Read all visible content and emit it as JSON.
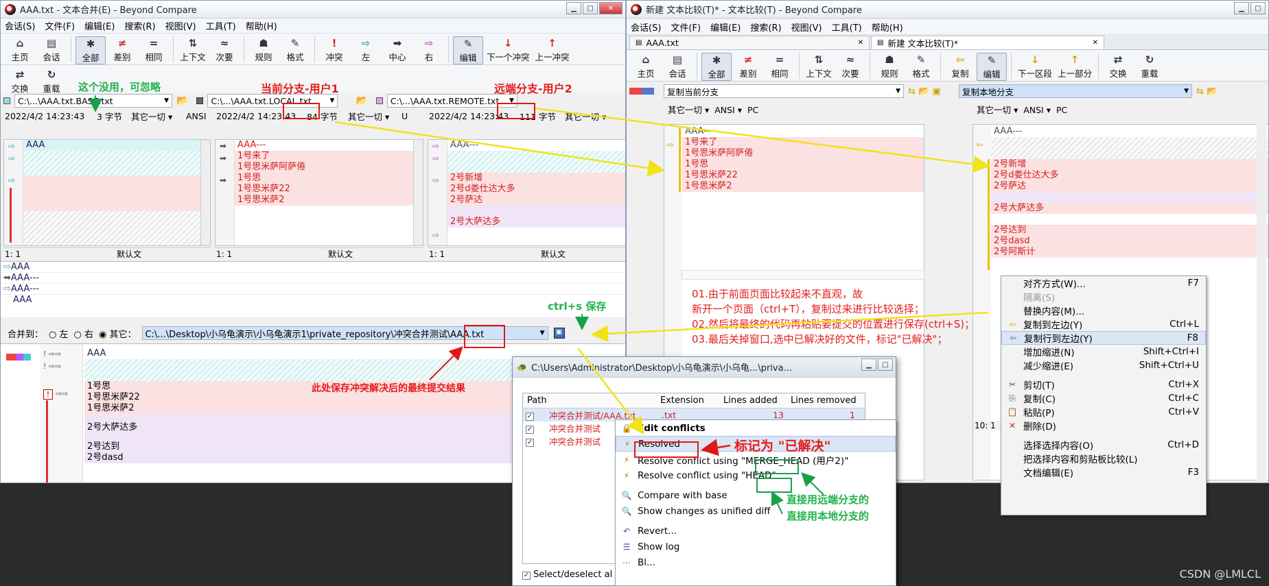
{
  "left_window": {
    "title": "AAA.txt - 文本合并(E) - Beyond Compare",
    "menu": [
      "会话(S)",
      "文件(F)",
      "编辑(E)",
      "搜索(R)",
      "视图(V)",
      "工具(T)",
      "帮助(H)"
    ],
    "toolbar": [
      "主页",
      "会话",
      "全部",
      "差别",
      "相同",
      "上下文",
      "次要",
      "规则",
      "格式",
      "冲突",
      "左",
      "中心",
      "右",
      "编辑",
      "下一个冲突",
      "上一冲突"
    ],
    "toolbar2": [
      "交换",
      "重载"
    ],
    "paths": {
      "base": "C:\\...\\AAA.txt.BASE.txt",
      "local": "C:\\...\\AAA.txt.LOCAL.txt",
      "remote": "C:\\...\\AAA.txt.REMOTE.txt"
    },
    "info": {
      "base": [
        "2022/4/2 14:23:43",
        "3 字节",
        "其它一切",
        "ANSI"
      ],
      "local": [
        "2022/4/2 14:23:43",
        "84 字节",
        "其它一切",
        "U"
      ],
      "remote": [
        "2022/4/2 14:23:43",
        "111 字节",
        "其它一切"
      ]
    },
    "base_lines": [
      "AAA"
    ],
    "local_lines": [
      "AAA---",
      "1号来了",
      "1号思米萨阿萨倦",
      "1号思",
      "1号思米萨22",
      "1号思米萨2"
    ],
    "remote_lines": [
      "AAA---",
      "2号新增",
      "2号d娄仕达大多",
      "2号萨达",
      "2号大萨达多"
    ],
    "status": {
      "pos": "1: 1",
      "default": "默认文"
    },
    "overview": [
      "AAA",
      "AAA---",
      "AAA---",
      "AAA"
    ],
    "merge_label": "合并到：",
    "merge_opts": [
      "左",
      "右",
      "其它："
    ],
    "merge_path": "C:\\...\\Desktop\\小乌龟演示\\小乌龟演示1\\private_repository\\冲突合并测试\\AAA.txt",
    "output_lines": [
      "AAA",
      "1号思",
      "1号思米萨22",
      "1号思米萨2",
      "2号大萨达多",
      "2号达到",
      "2号dasd"
    ]
  },
  "right_window": {
    "title": "新建 文本比较(T)* - 文本比较(T) - Beyond Compare",
    "menu": [
      "会话(S)",
      "文件(F)",
      "编辑(E)",
      "搜索(R)",
      "视图(V)",
      "工具(T)",
      "帮助(H)"
    ],
    "tabs": [
      "AAA.txt",
      "新建 文本比较(T)*"
    ],
    "toolbar": [
      "主页",
      "会话",
      "全部",
      "差别",
      "相同",
      "上下文",
      "次要",
      "规则",
      "格式",
      "复制",
      "编辑",
      "下一区段",
      "上一部分",
      "交换",
      "重载"
    ],
    "left_path": "复制当前分支",
    "right_path": "复制本地分支",
    "info": [
      "其它一切",
      "ANSI",
      "PC"
    ],
    "left_lines": [
      "AAA---",
      "1号来了",
      "1号思米萨阿萨倦",
      "1号思",
      "1号思米萨22",
      "1号思米萨2"
    ],
    "right_lines": [
      "AAA---",
      "2号新增",
      "2号d娄仕达大多",
      "2号萨达",
      "2号大萨达多",
      "2号达到",
      "2号dasd",
      "2号阿斯计"
    ],
    "status_pos": "10: 1"
  },
  "context_menu": [
    {
      "label": "对齐方式(W)...",
      "sc": "F7"
    },
    {
      "label": "隔离(S)",
      "sc": ""
    },
    {
      "label": "替换内容(M)...",
      "sc": ""
    },
    {
      "label": "复制到左边(Y)",
      "sc": "Ctrl+L"
    },
    {
      "label": "复制行到左边(Y)",
      "sc": "F8"
    },
    {
      "label": "增加缩进(N)",
      "sc": "Shift+Ctrl+I"
    },
    {
      "label": "减少缩进(E)",
      "sc": "Shift+Ctrl+U"
    },
    {
      "label": "剪切(T)",
      "sc": "Ctrl+X"
    },
    {
      "label": "复制(C)",
      "sc": "Ctrl+C"
    },
    {
      "label": "粘贴(P)",
      "sc": "Ctrl+V"
    },
    {
      "label": "删除(D)",
      "sc": ""
    },
    {
      "label": "选择选择内容(O)",
      "sc": "Ctrl+D"
    },
    {
      "label": "把选择内容和剪贴板比较(L)",
      "sc": ""
    },
    {
      "label": "文档编辑(E)",
      "sc": "F3"
    }
  ],
  "tortoise_dialog": {
    "title": "C:\\Users\\Administrator\\Desktop\\小乌龟演示\\小乌龟...\\priva...",
    "columns": [
      "Path",
      "Extension",
      "Lines added",
      "Lines removed"
    ],
    "rows": [
      {
        "path": "冲突合并测试/AAA.txt",
        "ext": ".txt",
        "added": "13",
        "removed": "1"
      },
      {
        "path": "冲突合并测试",
        "ext": "",
        "added": "",
        "removed": ""
      },
      {
        "path": "冲突合并测试",
        "ext": "",
        "added": "",
        "removed": ""
      }
    ],
    "select_all": "Select/deselect al"
  },
  "tortoise_menu": [
    {
      "label": "Edit conflicts",
      "bold": true
    },
    {
      "label": "Resolved"
    },
    {
      "label": "Resolve conflict using \"MERGE_HEAD (用户2)\""
    },
    {
      "label": "Resolve conflict using \"HEAD\""
    },
    {
      "label": "Compare with base"
    },
    {
      "label": "Show changes as unified diff"
    },
    {
      "label": "Revert..."
    },
    {
      "label": "Show log"
    },
    {
      "label": "Bl..."
    }
  ],
  "annotations": {
    "ignore": "这个没用，可忽略",
    "local": "当前分支-用户1",
    "remote": "远端分支-用户2",
    "save": "ctrl+s 保存",
    "result": "此处保存冲突解决后的最终提交结果",
    "resolved": "标记为 \"已解决\"",
    "use_remote": "直接用远端分支的",
    "use_local": "直接用本地分支的",
    "steps": [
      "01.由于前面页面比较起来不直观，故",
      "新开一个页面（ctrl+T），复制过来进行比较选择；",
      "02.然后将最终的代码再粘贴要提交的位置进行保存(ctrl+S)；",
      "03.最后关掉窗口,选中已解决好的文件，标记\"已解决\"；"
    ]
  },
  "watermark": "CSDN @LMLCL",
  "colors": {
    "accent_red": "#e01818",
    "accent_green": "#22b24b",
    "arrow_yellow": "#f2e21a",
    "diff_red": "#d21e1e"
  }
}
